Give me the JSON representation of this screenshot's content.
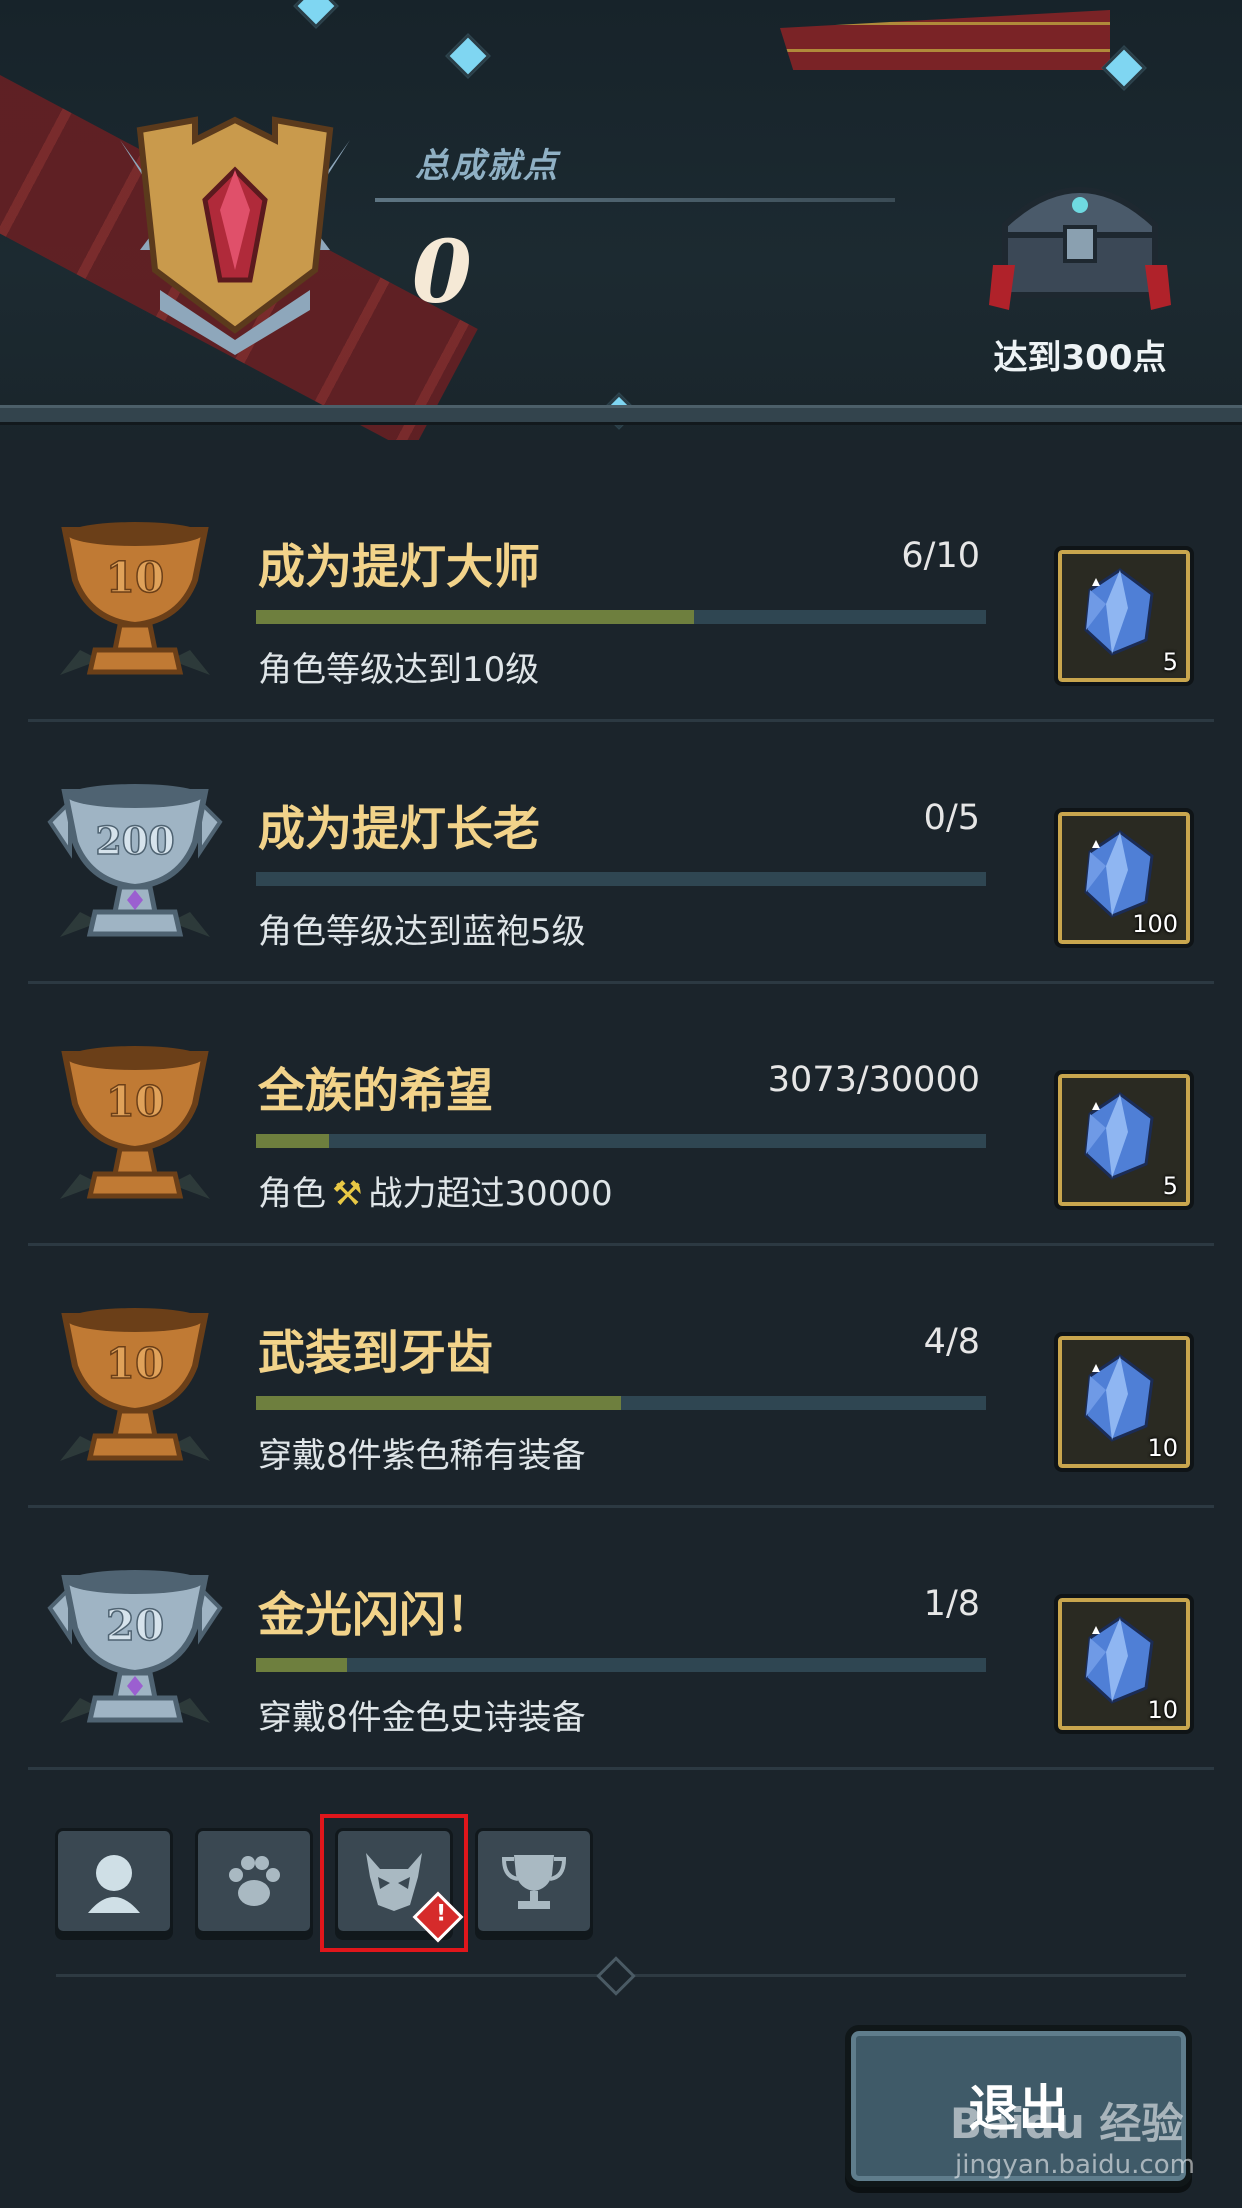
{
  "header": {
    "score_label": "总成就点",
    "score_value": "0",
    "chest_label": "达到300点"
  },
  "achievements": [
    {
      "trophy": "bronze",
      "trophy_number": "10",
      "title": "成为提灯大师",
      "count": "6/10",
      "progress": 0.6,
      "desc_pre": "角色等级达到10级",
      "desc_post": "",
      "reward_qty": "5"
    },
    {
      "trophy": "silver",
      "trophy_number": "200",
      "title": "成为提灯长老",
      "count": "0/5",
      "progress": 0.0,
      "desc_pre": "角色等级达到蓝袍5级",
      "desc_post": "",
      "reward_qty": "100"
    },
    {
      "trophy": "bronze",
      "trophy_number": "10",
      "title": "全族的希望",
      "count": "3073/30000",
      "progress": 0.1,
      "desc_pre": "角色",
      "desc_post": "战力超过30000",
      "reward_qty": "5"
    },
    {
      "trophy": "bronze",
      "trophy_number": "10",
      "title": "武装到牙齿",
      "count": "4/8",
      "progress": 0.5,
      "desc_pre": "穿戴8件紫色稀有装备",
      "desc_post": "",
      "reward_qty": "10"
    },
    {
      "trophy": "silver",
      "trophy_number": "20",
      "title": "金光闪闪！",
      "count": "1/8",
      "progress": 0.125,
      "desc_pre": "穿戴8件金色史诗装备",
      "desc_post": "",
      "reward_qty": "10"
    }
  ],
  "tabs": [
    {
      "icon": "character-icon",
      "active": true
    },
    {
      "icon": "paw-icon",
      "active": false
    },
    {
      "icon": "demon-mask-icon",
      "active": false,
      "alert": "!"
    },
    {
      "icon": "trophy-icon",
      "active": false
    }
  ],
  "exit_label": "退出",
  "watermark": {
    "main": "Baidu 经验",
    "sub": "jingyan.baidu.com"
  }
}
